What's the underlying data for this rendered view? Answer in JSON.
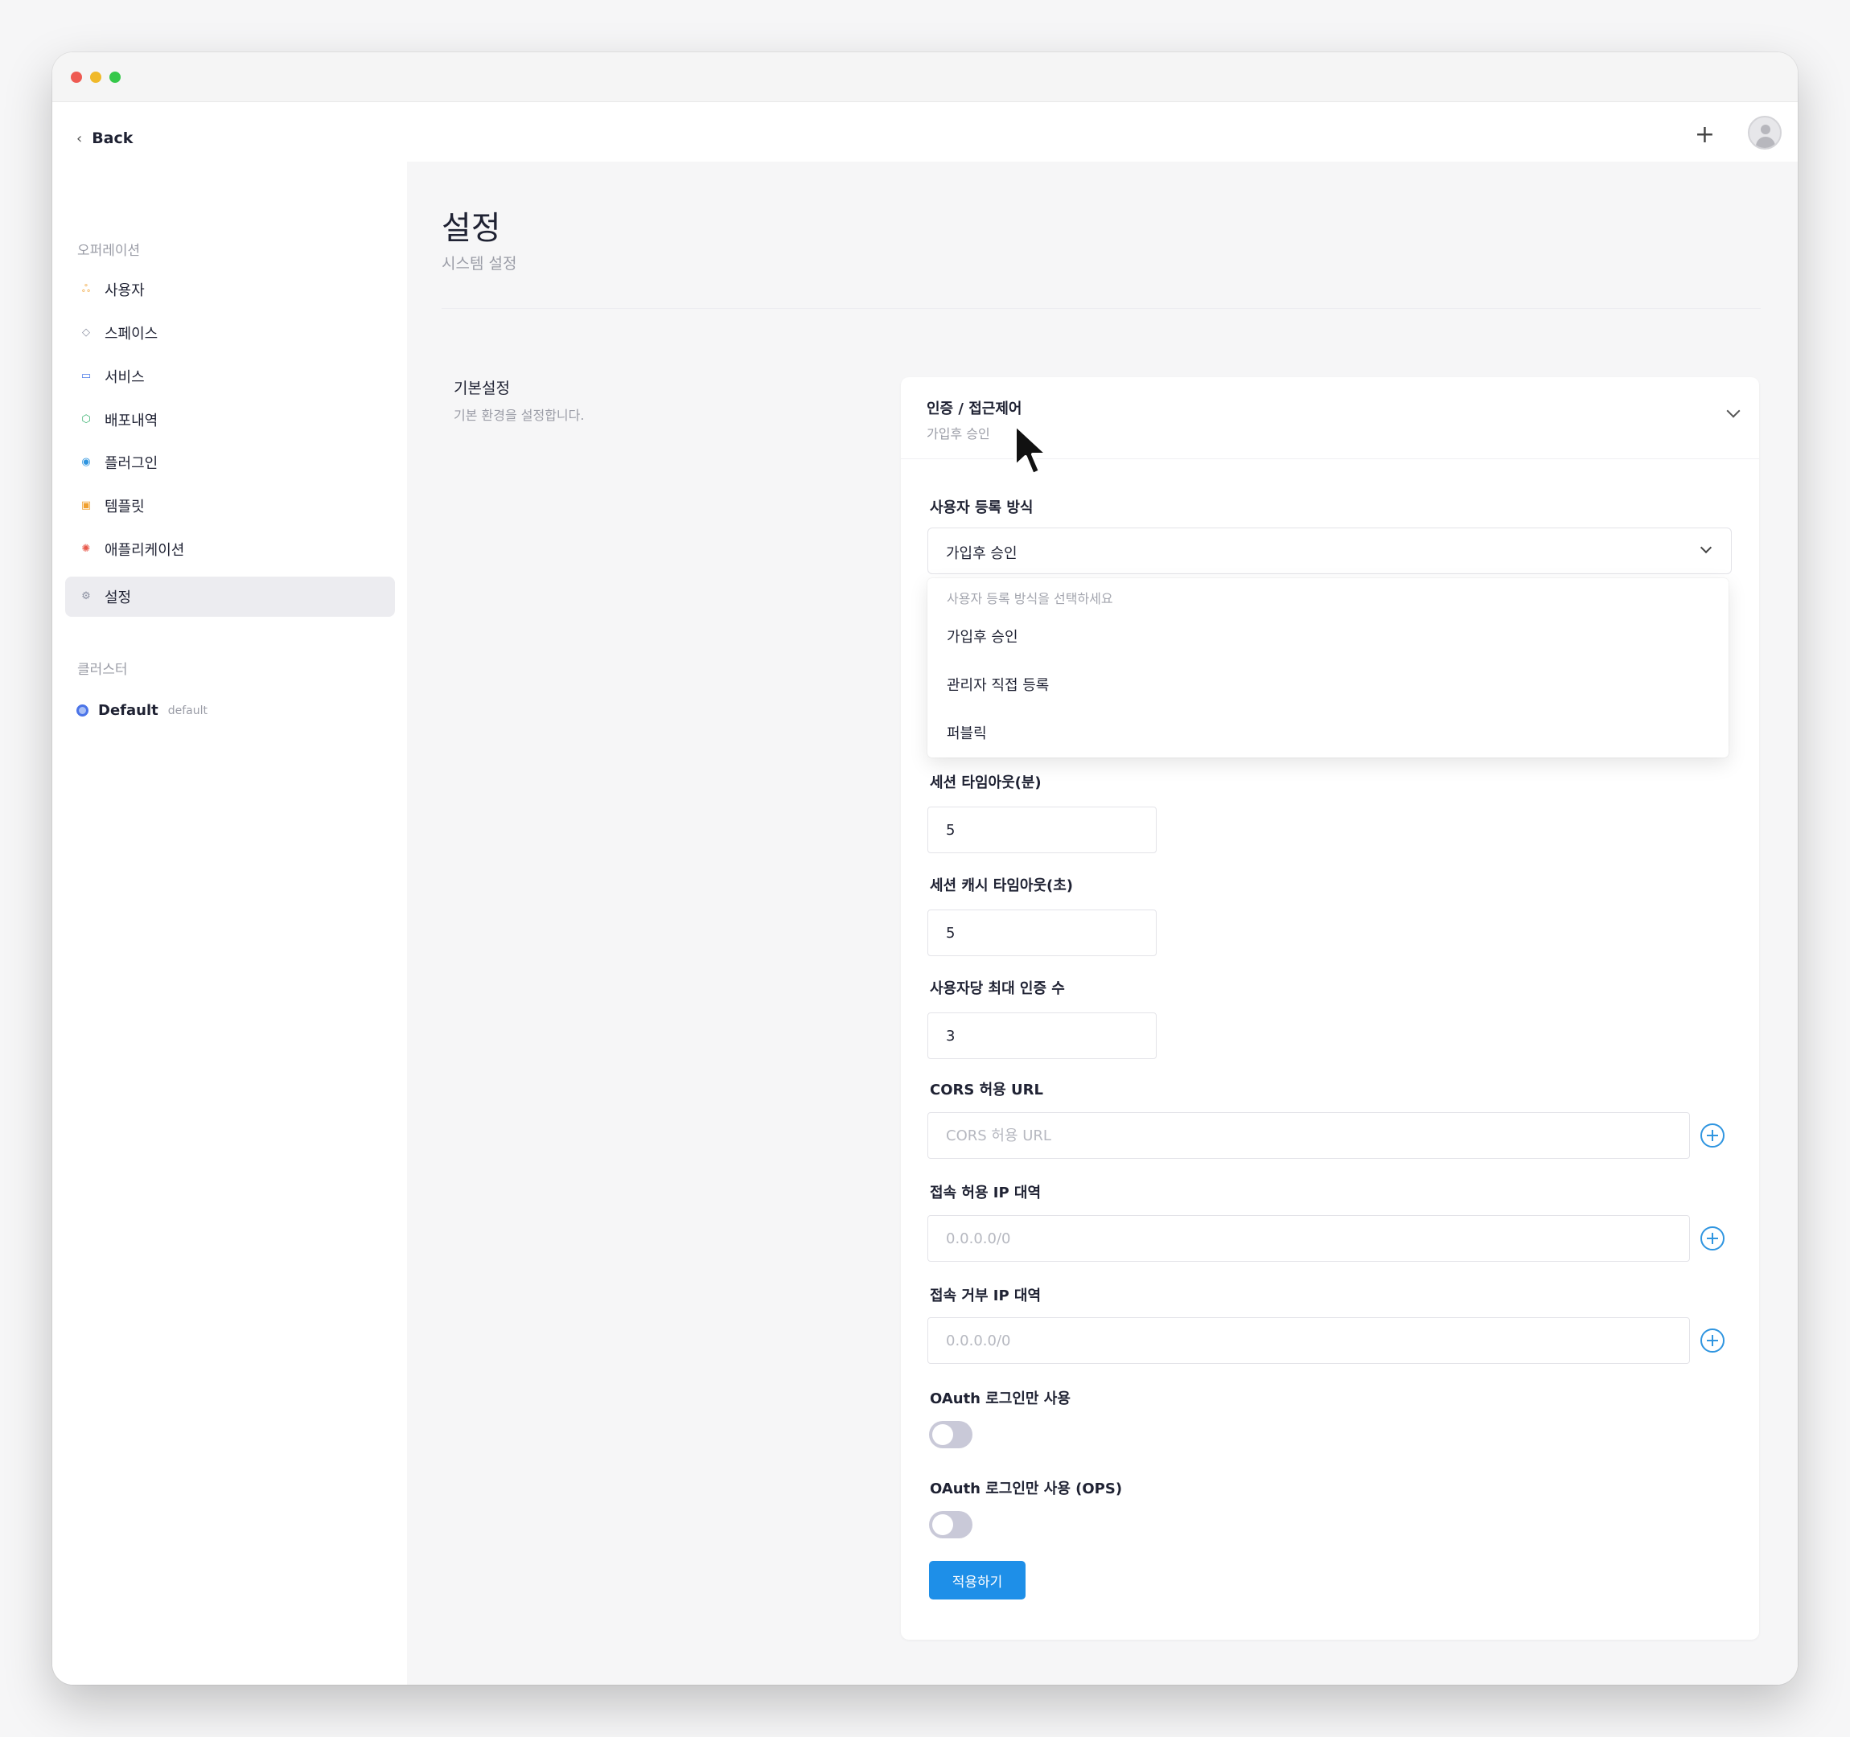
{
  "nav": {
    "back_label": "Back",
    "sections": [
      {
        "title": "오퍼레이션",
        "items": [
          {
            "label": "사용자",
            "icon": "users-icon",
            "color": "#f0a030",
            "active": false
          },
          {
            "label": "스페이스",
            "icon": "layers-icon",
            "color": "#8a8fa0",
            "active": false
          },
          {
            "label": "서비스",
            "icon": "window-icon",
            "color": "#4a7ae8",
            "active": false
          },
          {
            "label": "배포내역",
            "icon": "box-icon",
            "color": "#3cb371",
            "active": false
          },
          {
            "label": "플러그인",
            "icon": "plugin-icon",
            "color": "#2f95e0",
            "active": false
          },
          {
            "label": "템플릿",
            "icon": "package-icon",
            "color": "#f0a030",
            "active": false
          },
          {
            "label": "애플리케이션",
            "icon": "app-icon",
            "color": "#e8584a",
            "active": false
          },
          {
            "label": "설정",
            "icon": "gear-icon",
            "color": "#8a8fa0",
            "active": true
          }
        ]
      },
      {
        "title": "클러스터"
      }
    ],
    "cluster": {
      "name": "Default",
      "sub": "default"
    }
  },
  "header": {
    "plus_icon": "plus-icon",
    "avatar_icon": "user-avatar-icon"
  },
  "page": {
    "title": "설정",
    "subtitle": "시스템 설정",
    "group_title": "기본설정",
    "group_subtitle": "기본 환경을 설정합니다."
  },
  "card": {
    "title": "인증 / 접근제어",
    "subtitle": "가입후 승인",
    "registration": {
      "label": "사용자 등록 방식",
      "value": "가입후 승인",
      "placeholder": "사용자 등록 방식을 선택하세요",
      "options": [
        "가입후 승인",
        "관리자 직접 등록",
        "퍼블릭"
      ]
    },
    "session_timeout": {
      "label": "세션 타임아웃(분)",
      "value": "5"
    },
    "session_cache_timeout": {
      "label": "세션 캐시 타임아웃(초)",
      "value": "5"
    },
    "max_auth": {
      "label": "사용자당 최대 인증 수",
      "value": "3"
    },
    "cors": {
      "label": "CORS 허용 URL",
      "placeholder": "CORS 허용 URL"
    },
    "allow_ip": {
      "label": "접속 허용 IP 대역",
      "placeholder": "0.0.0.0/0"
    },
    "deny_ip": {
      "label": "접속 거부 IP 대역",
      "placeholder": "0.0.0.0/0"
    },
    "oauth_only": {
      "label": "OAuth 로그인만 사용",
      "enabled": false
    },
    "oauth_only_ops": {
      "label": "OAuth 로그인만 사용 (OPS)",
      "enabled": false
    },
    "apply_label": "적용하기"
  },
  "colors": {
    "accent": "#1e8fe8",
    "add_icon": "#2f95e0",
    "toggle_off": "#c9c9d8"
  }
}
